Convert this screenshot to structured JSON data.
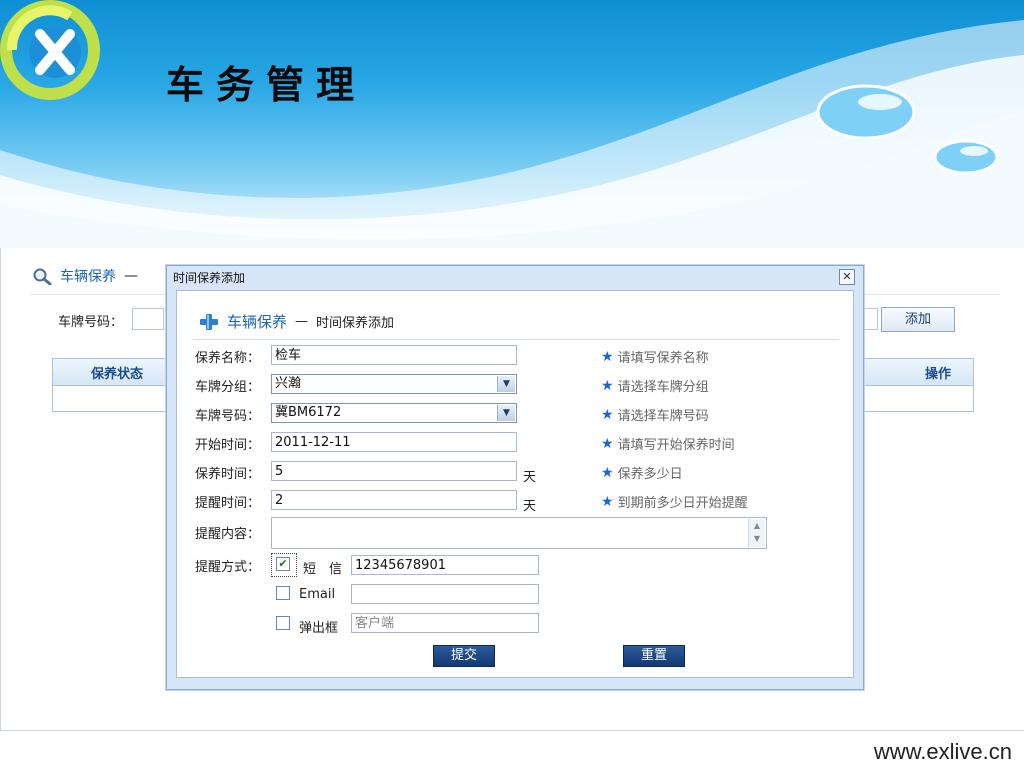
{
  "header": {
    "title": "车务管理"
  },
  "breadcrumb": {
    "section": "车辆保养",
    "separator": "—"
  },
  "toolbar": {
    "plate_label": "车牌号码：",
    "add_label": "添加"
  },
  "table": {
    "columns": [
      "保养状态",
      "操作"
    ]
  },
  "dialog": {
    "title": "时间保养添加",
    "close_glyph": "✕",
    "heading_section": "车辆保养",
    "heading_separator": "—",
    "heading_page": "时间保养添加",
    "fields": {
      "name": {
        "label": "保养名称：",
        "value": "检车",
        "hint": "请填写保养名称"
      },
      "group": {
        "label": "车牌分组：",
        "value": "兴瀚",
        "hint": "请选择车牌分组"
      },
      "plate": {
        "label": "车牌号码：",
        "value": "冀BM6172",
        "hint": "请选择车牌号码"
      },
      "start": {
        "label": "开始时间：",
        "value": "2011-12-11",
        "hint": "请填写开始保养时间"
      },
      "period": {
        "label": "保养时间：",
        "value": "5",
        "unit": "天",
        "hint": "保养多少日"
      },
      "remind": {
        "label": "提醒时间：",
        "value": "2",
        "unit": "天",
        "hint": "到期前多少日开始提醒"
      },
      "content": {
        "label": "提醒内容："
      },
      "method": {
        "label": "提醒方式：",
        "sms": {
          "label": "短　信",
          "checked": true,
          "value": "12345678901"
        },
        "email": {
          "label": "Email",
          "checked": false,
          "value": ""
        },
        "popup": {
          "label": "弹出框",
          "checked": false,
          "placeholder": "客户端"
        }
      }
    },
    "submit_label": "提交",
    "reset_label": "重置"
  },
  "footer": {
    "url": "www.exlive.cn"
  },
  "colors": {
    "accent": "#1b64b6",
    "button": "#1d4a86",
    "hint_star": "#1b64d6"
  },
  "icons": {
    "breadcrumb": "magnifier-icon",
    "form_heading": "plus-icon",
    "hint": "star-icon"
  }
}
